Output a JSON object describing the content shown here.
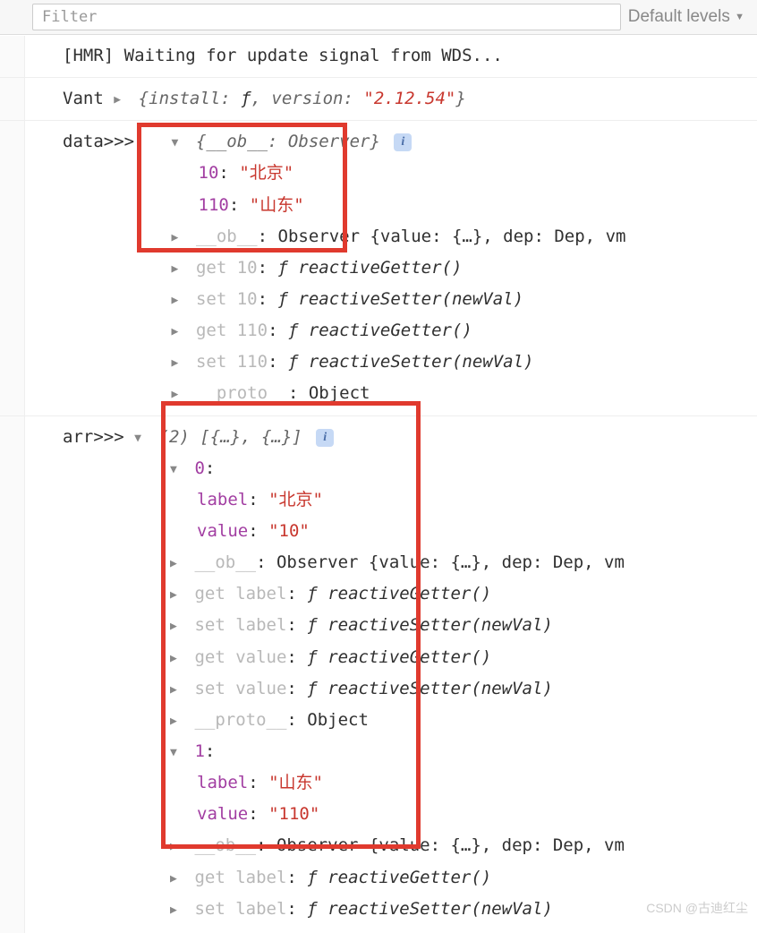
{
  "toolbar": {
    "filter_placeholder": "Filter",
    "levels_label": "Default levels"
  },
  "rows": {
    "hmr": "[HMR] Waiting for update signal from WDS...",
    "vant_label": "Vant",
    "vant_install": "install: ",
    "vant_f": "ƒ",
    "vant_version_key": ", version: ",
    "vant_version_val": "\"2.12.54\"",
    "data_label": "data>>>",
    "data_head": " {__ob__: Observer}",
    "d10_key": "10",
    "d10_val": "\"北京\"",
    "d110_key": "110",
    "d110_val": "\"山东\"",
    "ob_key": "__ob__",
    "ob_preview": "Observer {value: {…}, dep: Dep, vm",
    "get10": "get 10",
    "set10": "set 10",
    "get110": "get 110",
    "set110": "set 110",
    "rg": "reactiveGetter()",
    "rs": "reactiveSetter(newVal)",
    "proto": "__proto__",
    "proto_val": "Object",
    "arr_label": "arr>>>",
    "arr_head_count": "(2)",
    "arr_head_preview": " [{…}, {…}]",
    "idx0": "0",
    "idx1": "1",
    "label_key": "label",
    "value_key": "value",
    "bj": "\"北京\"",
    "sd": "\"山东\"",
    "v10": "\"10\"",
    "v110": "\"110\"",
    "getlabel": "get label",
    "setlabel": "set label",
    "getvalue": "get value",
    "setvalue": "set value",
    "ob_preview2": "Observer {value: {…}, dep: Dep, vm",
    "f": "ƒ "
  },
  "watermark": "CSDN @古迪红尘"
}
